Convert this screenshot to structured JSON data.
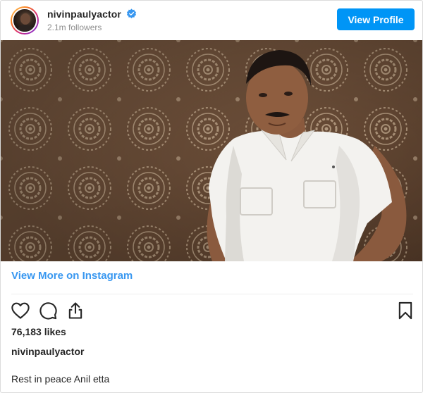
{
  "header": {
    "username": "nivinpaulyactor",
    "followers": "2.1m followers",
    "view_profile_label": "View Profile"
  },
  "post": {
    "view_more_label": "View More on Instagram",
    "likes": "76,183 likes",
    "caption_username": "nivinpaulyactor",
    "comment": "Rest in peace Anil etta"
  },
  "icons": {
    "verified": "verified-badge-icon",
    "like": "heart-icon",
    "comment": "comment-icon",
    "share": "share-icon",
    "save": "bookmark-icon"
  },
  "colors": {
    "accent": "#0095f6",
    "link": "#3897f0",
    "text": "#262626",
    "muted": "#8e8e8e",
    "divider": "#efefef"
  }
}
